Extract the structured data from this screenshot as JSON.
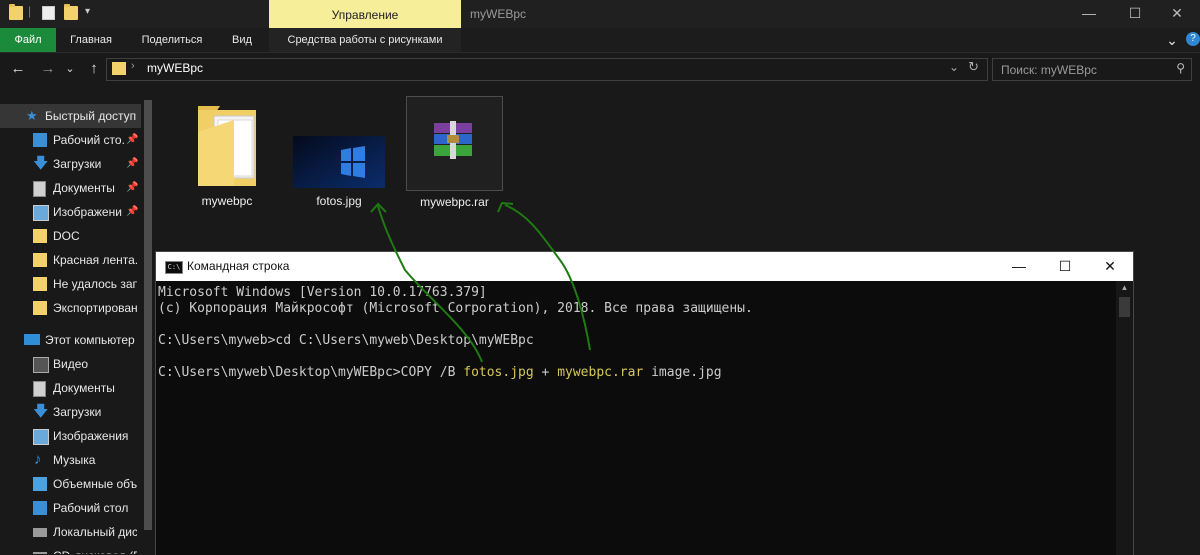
{
  "window": {
    "title": "myWEBpc",
    "manage_tab": "Управление",
    "minimize": "—",
    "maximize": "☐",
    "close": "✕"
  },
  "ribbon": {
    "tabs": [
      "Файл",
      "Главная",
      "Поделиться",
      "Вид",
      "Средства работы с рисунками"
    ],
    "collapse": "⌄",
    "help": "?"
  },
  "address": {
    "back": "←",
    "forward": "→",
    "recent": "⌄",
    "up": "↑",
    "separator": "›",
    "path": "myWEBpc",
    "dropdown": "⌄",
    "refresh": "↻"
  },
  "search": {
    "placeholder": "Поиск: myWEBpc",
    "icon": "search-icon"
  },
  "nav": {
    "quick_access": "Быстрый доступ",
    "pinned": [
      {
        "label": "Рабочий сто.",
        "icon": "desktop-icon",
        "pinned": true
      },
      {
        "label": "Загрузки",
        "icon": "download-icon",
        "pinned": true
      },
      {
        "label": "Документы",
        "icon": "documents-icon",
        "pinned": true
      },
      {
        "label": "Изображени",
        "icon": "pictures-icon",
        "pinned": true
      },
      {
        "label": "DOC",
        "icon": "folder-icon",
        "pinned": false
      },
      {
        "label": "Красная лента.(",
        "icon": "folder-icon",
        "pinned": false
      },
      {
        "label": "Не удалось запу",
        "icon": "folder-icon",
        "pinned": false
      },
      {
        "label": "Экспортирован",
        "icon": "folder-icon",
        "pinned": false
      }
    ],
    "this_pc": "Этот компьютер",
    "pc_items": [
      {
        "label": "Видео",
        "icon": "video-icon"
      },
      {
        "label": "Документы",
        "icon": "documents-icon"
      },
      {
        "label": "Загрузки",
        "icon": "download-icon"
      },
      {
        "label": "Изображения",
        "icon": "pictures-icon"
      },
      {
        "label": "Музыка",
        "icon": "music-icon"
      },
      {
        "label": "Объемные объ",
        "icon": "3d-objects-icon"
      },
      {
        "label": "Рабочий стол",
        "icon": "desktop-icon"
      },
      {
        "label": "Локальный дис",
        "icon": "drive-icon"
      },
      {
        "label": "CD-дисковод (E",
        "icon": "cd-drive-icon"
      }
    ]
  },
  "files": [
    {
      "name": "mywebpc",
      "type": "folder"
    },
    {
      "name": "fotos.jpg",
      "type": "image"
    },
    {
      "name": "mywebpc.rar",
      "type": "archive"
    }
  ],
  "cmd": {
    "title": "Командная строка",
    "icon_text": "C:\\",
    "lines": {
      "l1": "Microsoft Windows [Version 10.0.17763.379]",
      "l2": "(c) Корпорация Майкрософт (Microsoft Corporation), 2018. Все права защищены.",
      "l3": "C:\\Users\\myweb>cd C:\\Users\\myweb\\Desktop\\myWEBpc",
      "l4_prefix": "C:\\Users\\myweb\\Desktop\\myWEBpc>COPY /B ",
      "l4_file1": "fotos.jpg",
      "l4_plus": " + ",
      "l4_file2": "mywebpc.rar",
      "l4_suffix": " image.jpg"
    },
    "scroll_up": "▲"
  },
  "colors": {
    "accent_green": "#1b8a3a",
    "manage_tab": "#f6ee98",
    "highlight": "#d8c75c",
    "arrow_green": "#1f7a12",
    "background": "#191919"
  }
}
